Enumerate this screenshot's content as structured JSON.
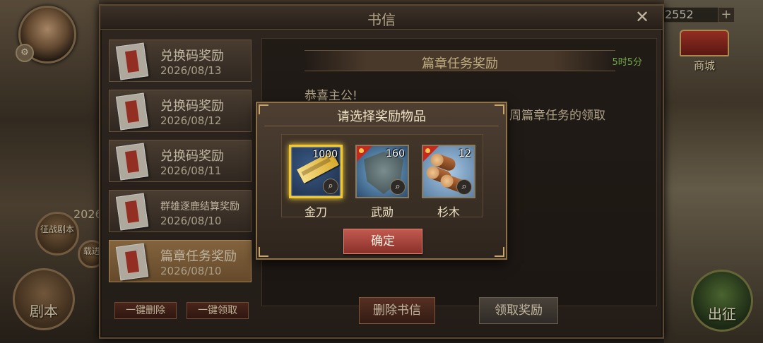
{
  "hud": {
    "currency_value": "2552",
    "plus_label": "+",
    "shop_label": "商城",
    "year_label": "2026",
    "left_btn_1": "征战剧本",
    "left_btn_2": "载进",
    "left_btn_3": "剧本",
    "go_label": "出征"
  },
  "mail": {
    "title": "书信",
    "close_label": "✕",
    "items": [
      {
        "title": "兑换码奖励",
        "date": "2026/08/13"
      },
      {
        "title": "兑换码奖励",
        "date": "2026/08/12"
      },
      {
        "title": "兑换码奖励",
        "date": "2026/08/11"
      },
      {
        "title": "群雄逐鹿结算奖励",
        "date": "2026/08/10"
      },
      {
        "title": "篇章任务奖励",
        "date": "2026/08/10"
      }
    ],
    "delete_all_label": "一键删除",
    "claim_all_label": "一键领取",
    "content": {
      "title": "篇章任务奖励",
      "timer": "5时5分",
      "greeting": "恭喜主公!",
      "body": "周篇章任务的领取"
    },
    "delete_label": "删除书信",
    "claim_label": "领取奖励"
  },
  "popup": {
    "title": "请选择奖励物品",
    "rewards": [
      {
        "name": "金刀",
        "count": "1000",
        "icon": "golden-blade-icon"
      },
      {
        "name": "武勋",
        "count": "160",
        "icon": "armor-plate-icon"
      },
      {
        "name": "杉木",
        "count": "12",
        "icon": "wood-logs-icon"
      }
    ],
    "confirm_label": "确定"
  },
  "colors": {
    "selected_border": "#f2c82a",
    "confirm_button": "#c25a50",
    "timer_text": "#8ccf5a"
  }
}
